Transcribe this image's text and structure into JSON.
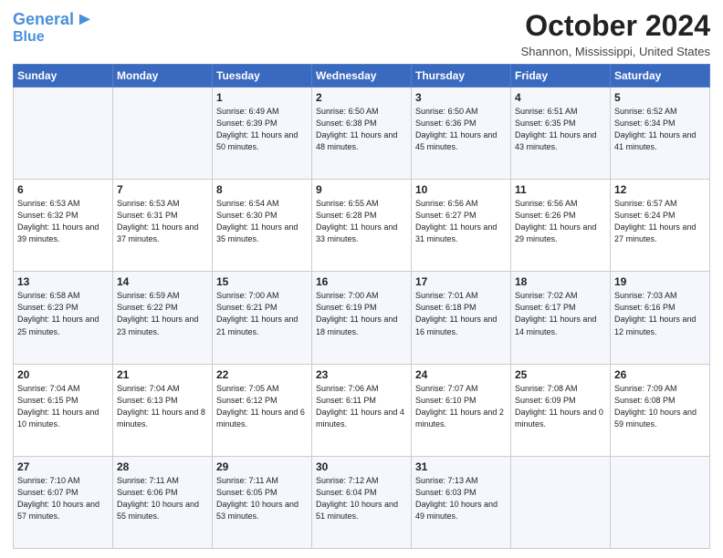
{
  "header": {
    "logo_line1": "General",
    "logo_line2": "Blue",
    "month": "October 2024",
    "location": "Shannon, Mississippi, United States"
  },
  "days_of_week": [
    "Sunday",
    "Monday",
    "Tuesday",
    "Wednesday",
    "Thursday",
    "Friday",
    "Saturday"
  ],
  "weeks": [
    [
      {
        "day": "",
        "info": ""
      },
      {
        "day": "",
        "info": ""
      },
      {
        "day": "1",
        "info": "Sunrise: 6:49 AM\nSunset: 6:39 PM\nDaylight: 11 hours and 50 minutes."
      },
      {
        "day": "2",
        "info": "Sunrise: 6:50 AM\nSunset: 6:38 PM\nDaylight: 11 hours and 48 minutes."
      },
      {
        "day": "3",
        "info": "Sunrise: 6:50 AM\nSunset: 6:36 PM\nDaylight: 11 hours and 45 minutes."
      },
      {
        "day": "4",
        "info": "Sunrise: 6:51 AM\nSunset: 6:35 PM\nDaylight: 11 hours and 43 minutes."
      },
      {
        "day": "5",
        "info": "Sunrise: 6:52 AM\nSunset: 6:34 PM\nDaylight: 11 hours and 41 minutes."
      }
    ],
    [
      {
        "day": "6",
        "info": "Sunrise: 6:53 AM\nSunset: 6:32 PM\nDaylight: 11 hours and 39 minutes."
      },
      {
        "day": "7",
        "info": "Sunrise: 6:53 AM\nSunset: 6:31 PM\nDaylight: 11 hours and 37 minutes."
      },
      {
        "day": "8",
        "info": "Sunrise: 6:54 AM\nSunset: 6:30 PM\nDaylight: 11 hours and 35 minutes."
      },
      {
        "day": "9",
        "info": "Sunrise: 6:55 AM\nSunset: 6:28 PM\nDaylight: 11 hours and 33 minutes."
      },
      {
        "day": "10",
        "info": "Sunrise: 6:56 AM\nSunset: 6:27 PM\nDaylight: 11 hours and 31 minutes."
      },
      {
        "day": "11",
        "info": "Sunrise: 6:56 AM\nSunset: 6:26 PM\nDaylight: 11 hours and 29 minutes."
      },
      {
        "day": "12",
        "info": "Sunrise: 6:57 AM\nSunset: 6:24 PM\nDaylight: 11 hours and 27 minutes."
      }
    ],
    [
      {
        "day": "13",
        "info": "Sunrise: 6:58 AM\nSunset: 6:23 PM\nDaylight: 11 hours and 25 minutes."
      },
      {
        "day": "14",
        "info": "Sunrise: 6:59 AM\nSunset: 6:22 PM\nDaylight: 11 hours and 23 minutes."
      },
      {
        "day": "15",
        "info": "Sunrise: 7:00 AM\nSunset: 6:21 PM\nDaylight: 11 hours and 21 minutes."
      },
      {
        "day": "16",
        "info": "Sunrise: 7:00 AM\nSunset: 6:19 PM\nDaylight: 11 hours and 18 minutes."
      },
      {
        "day": "17",
        "info": "Sunrise: 7:01 AM\nSunset: 6:18 PM\nDaylight: 11 hours and 16 minutes."
      },
      {
        "day": "18",
        "info": "Sunrise: 7:02 AM\nSunset: 6:17 PM\nDaylight: 11 hours and 14 minutes."
      },
      {
        "day": "19",
        "info": "Sunrise: 7:03 AM\nSunset: 6:16 PM\nDaylight: 11 hours and 12 minutes."
      }
    ],
    [
      {
        "day": "20",
        "info": "Sunrise: 7:04 AM\nSunset: 6:15 PM\nDaylight: 11 hours and 10 minutes."
      },
      {
        "day": "21",
        "info": "Sunrise: 7:04 AM\nSunset: 6:13 PM\nDaylight: 11 hours and 8 minutes."
      },
      {
        "day": "22",
        "info": "Sunrise: 7:05 AM\nSunset: 6:12 PM\nDaylight: 11 hours and 6 minutes."
      },
      {
        "day": "23",
        "info": "Sunrise: 7:06 AM\nSunset: 6:11 PM\nDaylight: 11 hours and 4 minutes."
      },
      {
        "day": "24",
        "info": "Sunrise: 7:07 AM\nSunset: 6:10 PM\nDaylight: 11 hours and 2 minutes."
      },
      {
        "day": "25",
        "info": "Sunrise: 7:08 AM\nSunset: 6:09 PM\nDaylight: 11 hours and 0 minutes."
      },
      {
        "day": "26",
        "info": "Sunrise: 7:09 AM\nSunset: 6:08 PM\nDaylight: 10 hours and 59 minutes."
      }
    ],
    [
      {
        "day": "27",
        "info": "Sunrise: 7:10 AM\nSunset: 6:07 PM\nDaylight: 10 hours and 57 minutes."
      },
      {
        "day": "28",
        "info": "Sunrise: 7:11 AM\nSunset: 6:06 PM\nDaylight: 10 hours and 55 minutes."
      },
      {
        "day": "29",
        "info": "Sunrise: 7:11 AM\nSunset: 6:05 PM\nDaylight: 10 hours and 53 minutes."
      },
      {
        "day": "30",
        "info": "Sunrise: 7:12 AM\nSunset: 6:04 PM\nDaylight: 10 hours and 51 minutes."
      },
      {
        "day": "31",
        "info": "Sunrise: 7:13 AM\nSunset: 6:03 PM\nDaylight: 10 hours and 49 minutes."
      },
      {
        "day": "",
        "info": ""
      },
      {
        "day": "",
        "info": ""
      }
    ]
  ]
}
